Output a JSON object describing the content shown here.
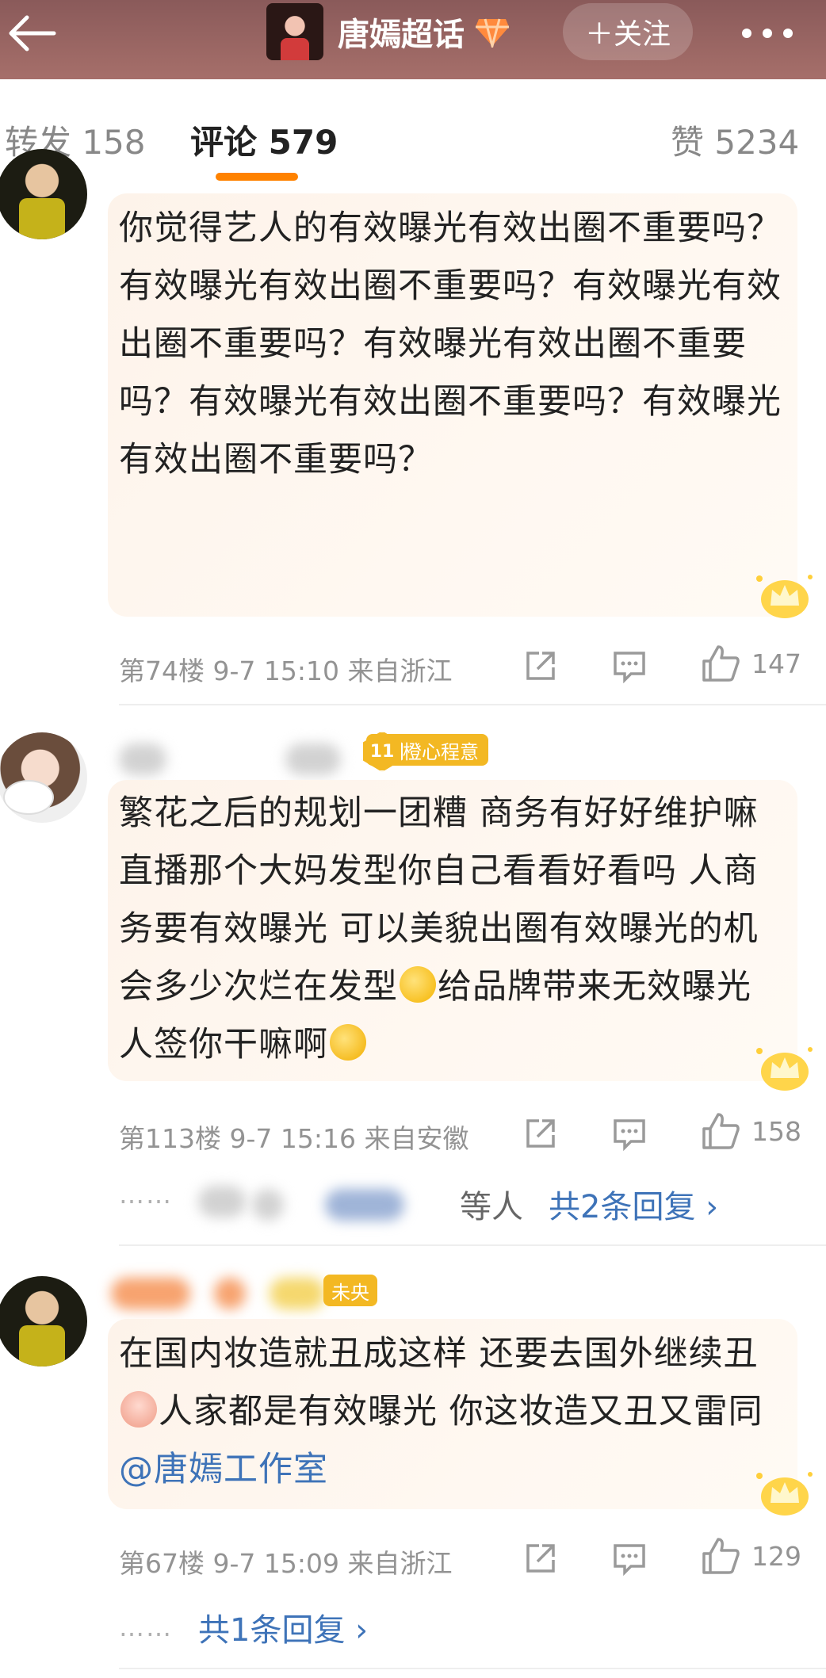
{
  "header": {
    "topic_title": "唐嫣超话",
    "follow_label": "＋关注"
  },
  "tabs": [
    {
      "label": "转发 158"
    },
    {
      "label": "评论 579"
    },
    {
      "label": "赞 5234"
    }
  ],
  "comments": [
    {
      "text": "你觉得艺人的有效曝光有效出圈不重要吗？有效曝光有效出圈不重要吗？有效曝光有效出圈不重要吗？有效曝光有效出圈不重要吗？有效曝光有效出圈不重要吗？有效曝光有效出圈不重要吗？",
      "meta": "第74楼  9-7 15:10  来自浙江",
      "likes": "147"
    },
    {
      "badge_level": "11",
      "badge_label": "橙心程意",
      "text_line_1": "繁花之后的规划一团糟 商务有好好维护嘛 直播那个大妈发型你自己看看好看吗 人商务要有效曝光 可以美貌出圈有效曝光的机会多少次烂在发型",
      "text_line_2": "给品牌带来无效曝光人签你干嘛啊",
      "meta": "第113楼  9-7 15:16  来自安徽",
      "likes": "158",
      "reply_etc": "等人",
      "reply_count": "共2条回复 ›"
    },
    {
      "badge_label": "未央",
      "text_part_1": "在国内妆造就丑成这样 还要去国外继续丑",
      "text_part_2": "人家都是有效曝光 你这妆造又丑又雷同",
      "mention": "@唐嫣工作室",
      "meta": "第67楼  9-7 15:09  来自浙江",
      "likes": "129",
      "reply_count": "共1条回复 ›"
    }
  ],
  "reply_dots": "……"
}
